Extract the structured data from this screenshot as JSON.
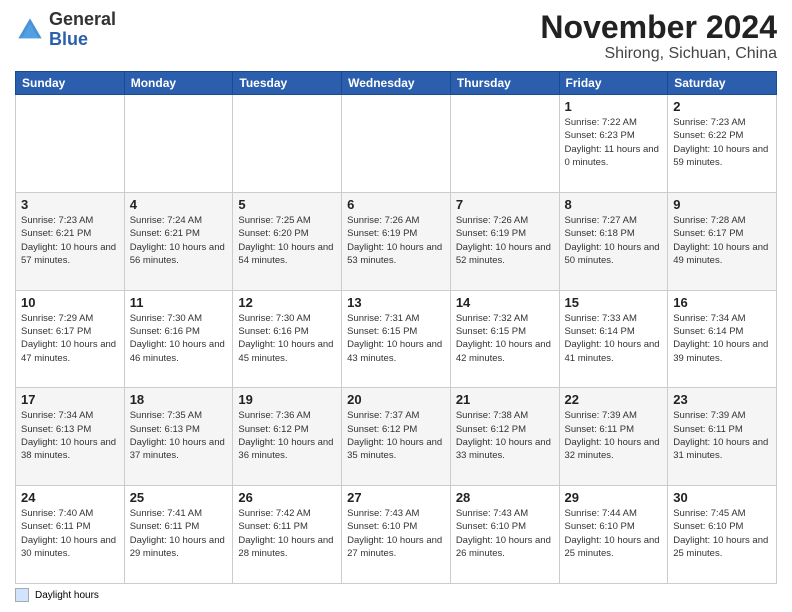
{
  "header": {
    "logo_line1": "General",
    "logo_line2": "Blue",
    "month_title": "November 2024",
    "location": "Shirong, Sichuan, China"
  },
  "days_of_week": [
    "Sunday",
    "Monday",
    "Tuesday",
    "Wednesday",
    "Thursday",
    "Friday",
    "Saturday"
  ],
  "legend_label": "Daylight hours",
  "weeks": [
    [
      {
        "day": "",
        "info": ""
      },
      {
        "day": "",
        "info": ""
      },
      {
        "day": "",
        "info": ""
      },
      {
        "day": "",
        "info": ""
      },
      {
        "day": "",
        "info": ""
      },
      {
        "day": "1",
        "info": "Sunrise: 7:22 AM\nSunset: 6:23 PM\nDaylight: 11 hours\nand 0 minutes."
      },
      {
        "day": "2",
        "info": "Sunrise: 7:23 AM\nSunset: 6:22 PM\nDaylight: 10 hours\nand 59 minutes."
      }
    ],
    [
      {
        "day": "3",
        "info": "Sunrise: 7:23 AM\nSunset: 6:21 PM\nDaylight: 10 hours\nand 57 minutes."
      },
      {
        "day": "4",
        "info": "Sunrise: 7:24 AM\nSunset: 6:21 PM\nDaylight: 10 hours\nand 56 minutes."
      },
      {
        "day": "5",
        "info": "Sunrise: 7:25 AM\nSunset: 6:20 PM\nDaylight: 10 hours\nand 54 minutes."
      },
      {
        "day": "6",
        "info": "Sunrise: 7:26 AM\nSunset: 6:19 PM\nDaylight: 10 hours\nand 53 minutes."
      },
      {
        "day": "7",
        "info": "Sunrise: 7:26 AM\nSunset: 6:19 PM\nDaylight: 10 hours\nand 52 minutes."
      },
      {
        "day": "8",
        "info": "Sunrise: 7:27 AM\nSunset: 6:18 PM\nDaylight: 10 hours\nand 50 minutes."
      },
      {
        "day": "9",
        "info": "Sunrise: 7:28 AM\nSunset: 6:17 PM\nDaylight: 10 hours\nand 49 minutes."
      }
    ],
    [
      {
        "day": "10",
        "info": "Sunrise: 7:29 AM\nSunset: 6:17 PM\nDaylight: 10 hours\nand 47 minutes."
      },
      {
        "day": "11",
        "info": "Sunrise: 7:30 AM\nSunset: 6:16 PM\nDaylight: 10 hours\nand 46 minutes."
      },
      {
        "day": "12",
        "info": "Sunrise: 7:30 AM\nSunset: 6:16 PM\nDaylight: 10 hours\nand 45 minutes."
      },
      {
        "day": "13",
        "info": "Sunrise: 7:31 AM\nSunset: 6:15 PM\nDaylight: 10 hours\nand 43 minutes."
      },
      {
        "day": "14",
        "info": "Sunrise: 7:32 AM\nSunset: 6:15 PM\nDaylight: 10 hours\nand 42 minutes."
      },
      {
        "day": "15",
        "info": "Sunrise: 7:33 AM\nSunset: 6:14 PM\nDaylight: 10 hours\nand 41 minutes."
      },
      {
        "day": "16",
        "info": "Sunrise: 7:34 AM\nSunset: 6:14 PM\nDaylight: 10 hours\nand 39 minutes."
      }
    ],
    [
      {
        "day": "17",
        "info": "Sunrise: 7:34 AM\nSunset: 6:13 PM\nDaylight: 10 hours\nand 38 minutes."
      },
      {
        "day": "18",
        "info": "Sunrise: 7:35 AM\nSunset: 6:13 PM\nDaylight: 10 hours\nand 37 minutes."
      },
      {
        "day": "19",
        "info": "Sunrise: 7:36 AM\nSunset: 6:12 PM\nDaylight: 10 hours\nand 36 minutes."
      },
      {
        "day": "20",
        "info": "Sunrise: 7:37 AM\nSunset: 6:12 PM\nDaylight: 10 hours\nand 35 minutes."
      },
      {
        "day": "21",
        "info": "Sunrise: 7:38 AM\nSunset: 6:12 PM\nDaylight: 10 hours\nand 33 minutes."
      },
      {
        "day": "22",
        "info": "Sunrise: 7:39 AM\nSunset: 6:11 PM\nDaylight: 10 hours\nand 32 minutes."
      },
      {
        "day": "23",
        "info": "Sunrise: 7:39 AM\nSunset: 6:11 PM\nDaylight: 10 hours\nand 31 minutes."
      }
    ],
    [
      {
        "day": "24",
        "info": "Sunrise: 7:40 AM\nSunset: 6:11 PM\nDaylight: 10 hours\nand 30 minutes."
      },
      {
        "day": "25",
        "info": "Sunrise: 7:41 AM\nSunset: 6:11 PM\nDaylight: 10 hours\nand 29 minutes."
      },
      {
        "day": "26",
        "info": "Sunrise: 7:42 AM\nSunset: 6:11 PM\nDaylight: 10 hours\nand 28 minutes."
      },
      {
        "day": "27",
        "info": "Sunrise: 7:43 AM\nSunset: 6:10 PM\nDaylight: 10 hours\nand 27 minutes."
      },
      {
        "day": "28",
        "info": "Sunrise: 7:43 AM\nSunset: 6:10 PM\nDaylight: 10 hours\nand 26 minutes."
      },
      {
        "day": "29",
        "info": "Sunrise: 7:44 AM\nSunset: 6:10 PM\nDaylight: 10 hours\nand 25 minutes."
      },
      {
        "day": "30",
        "info": "Sunrise: 7:45 AM\nSunset: 6:10 PM\nDaylight: 10 hours\nand 25 minutes."
      }
    ]
  ]
}
